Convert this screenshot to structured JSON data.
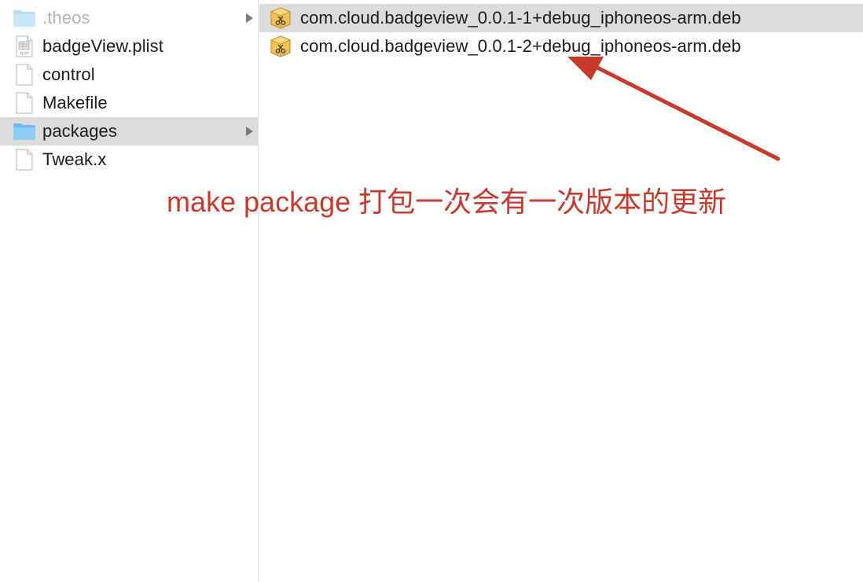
{
  "left_column": {
    "items": [
      {
        "label": ".theos",
        "icon": "folder-icon",
        "dimmed": true,
        "has_children": true,
        "selected": false
      },
      {
        "label": "badgeView.plist",
        "icon": "plist-file-icon",
        "dimmed": false,
        "has_children": false,
        "selected": false
      },
      {
        "label": "control",
        "icon": "document-icon",
        "dimmed": false,
        "has_children": false,
        "selected": false
      },
      {
        "label": "Makefile",
        "icon": "document-icon",
        "dimmed": false,
        "has_children": false,
        "selected": false
      },
      {
        "label": "packages",
        "icon": "folder-icon",
        "dimmed": false,
        "has_children": true,
        "selected": true
      },
      {
        "label": "Tweak.x",
        "icon": "document-icon",
        "dimmed": false,
        "has_children": false,
        "selected": false
      }
    ]
  },
  "right_column": {
    "items": [
      {
        "label": "com.cloud.badgeview_0.0.1-1+debug_iphoneos-arm.deb",
        "icon": "deb-package-icon",
        "selected": true
      },
      {
        "label": "com.cloud.badgeview_0.0.1-2+debug_iphoneos-arm.deb",
        "icon": "deb-package-icon",
        "selected": false
      }
    ]
  },
  "annotation": {
    "text": "make package 打包一次会有一次版本的更新",
    "color": "#c83a2b"
  },
  "colors": {
    "selection": "#dcdcdc",
    "folder": "#8fcdf5",
    "annotation_red": "#c83a2b"
  }
}
